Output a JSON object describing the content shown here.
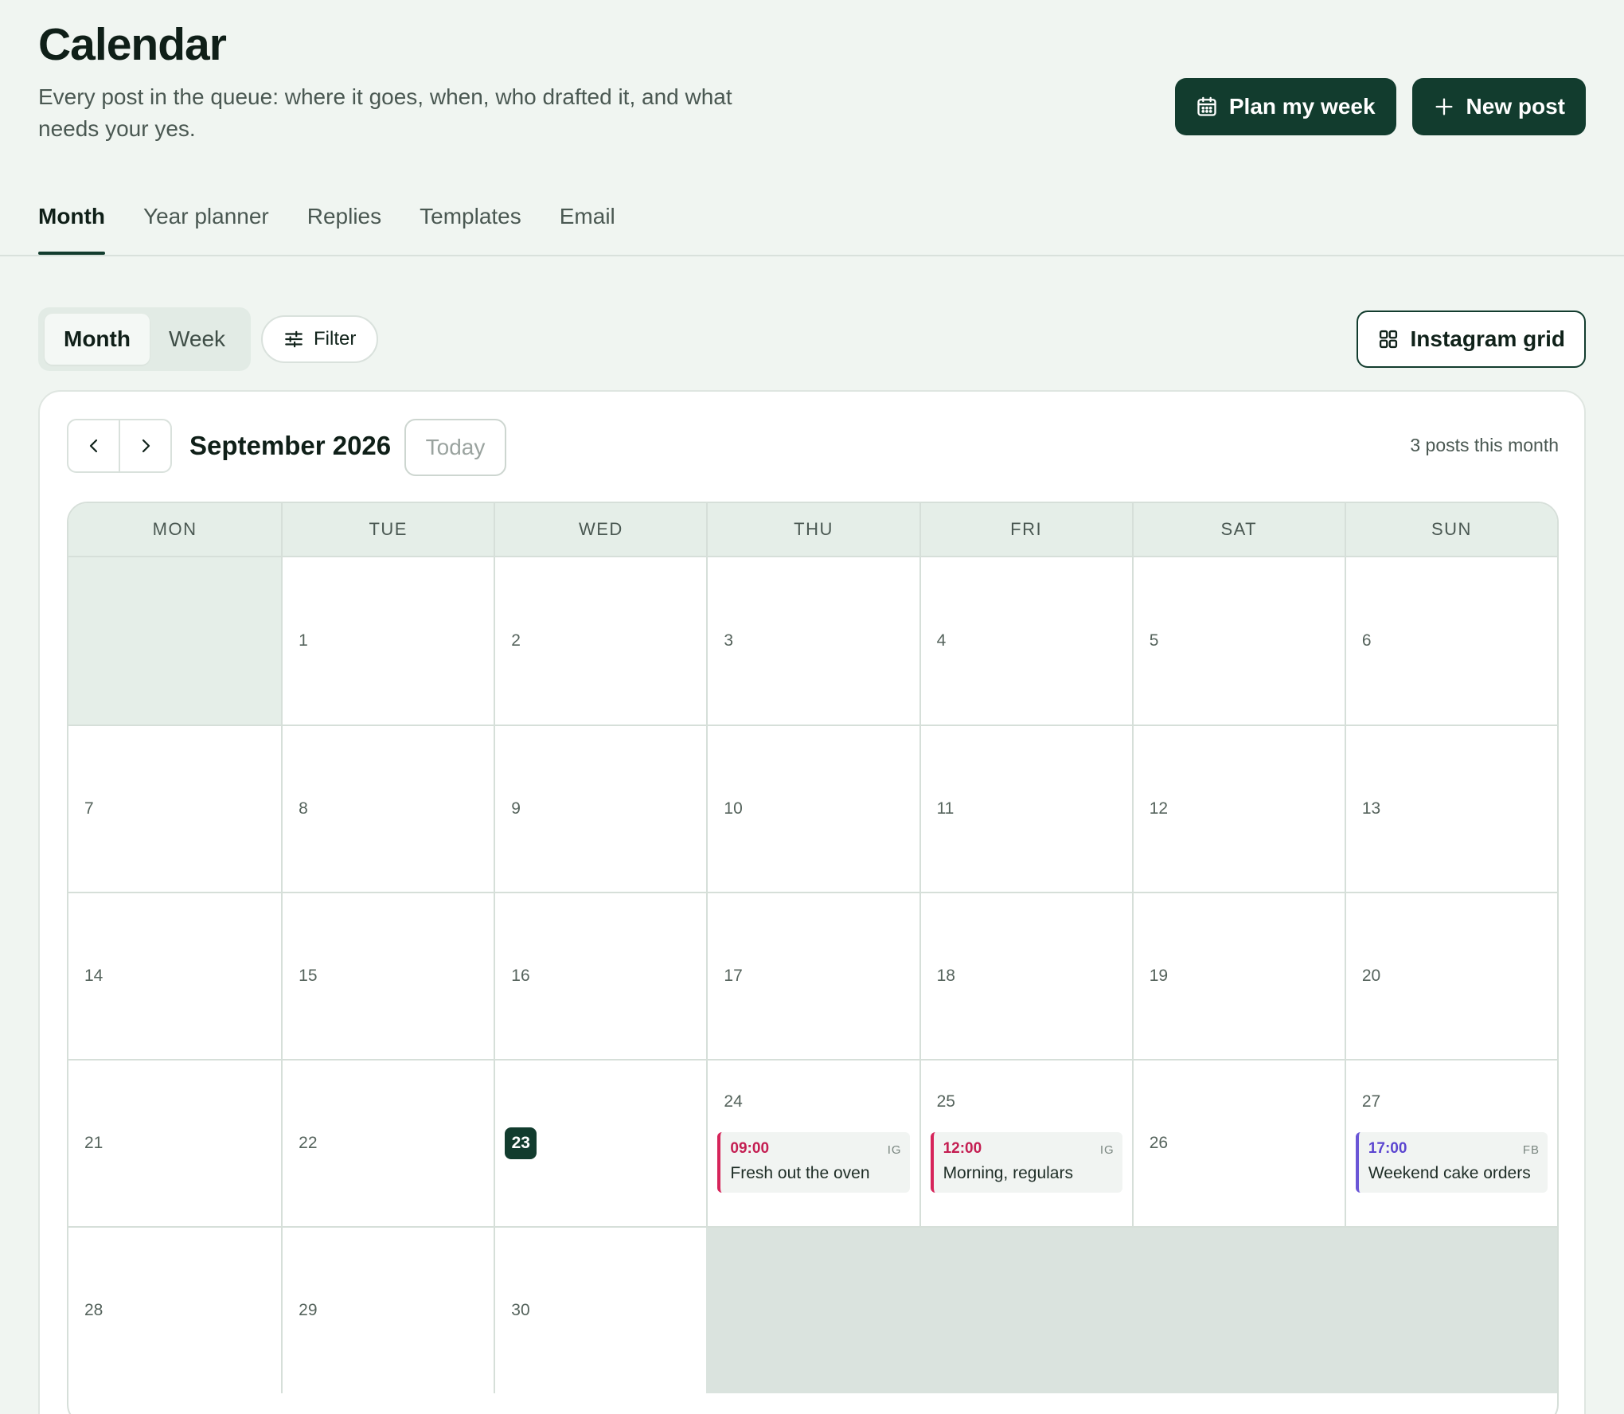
{
  "header": {
    "title": "Calendar",
    "subtitle": "Every post in the queue: where it goes, when, who drafted it, and what needs your yes.",
    "plan_label": "Plan my week",
    "new_post_label": "New post"
  },
  "tabs": [
    {
      "label": "Month",
      "active": true
    },
    {
      "label": "Year planner"
    },
    {
      "label": "Replies"
    },
    {
      "label": "Templates"
    },
    {
      "label": "Email"
    }
  ],
  "toolbar": {
    "view_month": "Month",
    "view_week": "Week",
    "filter_label": "Filter",
    "instagram_grid_label": "Instagram grid"
  },
  "calendar": {
    "month_label": "September 2026",
    "today_label": "Today",
    "posts_count": "3 posts this month",
    "weekdays": [
      "MON",
      "TUE",
      "WED",
      "THU",
      "FRI",
      "SAT",
      "SUN"
    ],
    "today": "23",
    "weeks": [
      [
        "",
        "1",
        "2",
        "3",
        "4",
        "5",
        "6"
      ],
      [
        "7",
        "8",
        "9",
        "10",
        "11",
        "12",
        "13"
      ],
      [
        "14",
        "15",
        "16",
        "17",
        "18",
        "19",
        "20"
      ],
      [
        "21",
        "22",
        "23",
        "24",
        "25",
        "26",
        "27"
      ],
      [
        "28",
        "29",
        "30"
      ]
    ],
    "events": [
      {
        "day": "24",
        "time": "09:00",
        "network": "IG",
        "title": "Fresh out the oven"
      },
      {
        "day": "25",
        "time": "12:00",
        "network": "IG",
        "title": "Morning, regulars"
      },
      {
        "day": "27",
        "time": "17:00",
        "network": "FB",
        "title": "Weekend cake orders"
      }
    ]
  },
  "colors": {
    "brand": "#123c2e",
    "background": "#f0f5f1",
    "instagram_accent": "#d6245a",
    "facebook_accent": "#6a56d6"
  }
}
